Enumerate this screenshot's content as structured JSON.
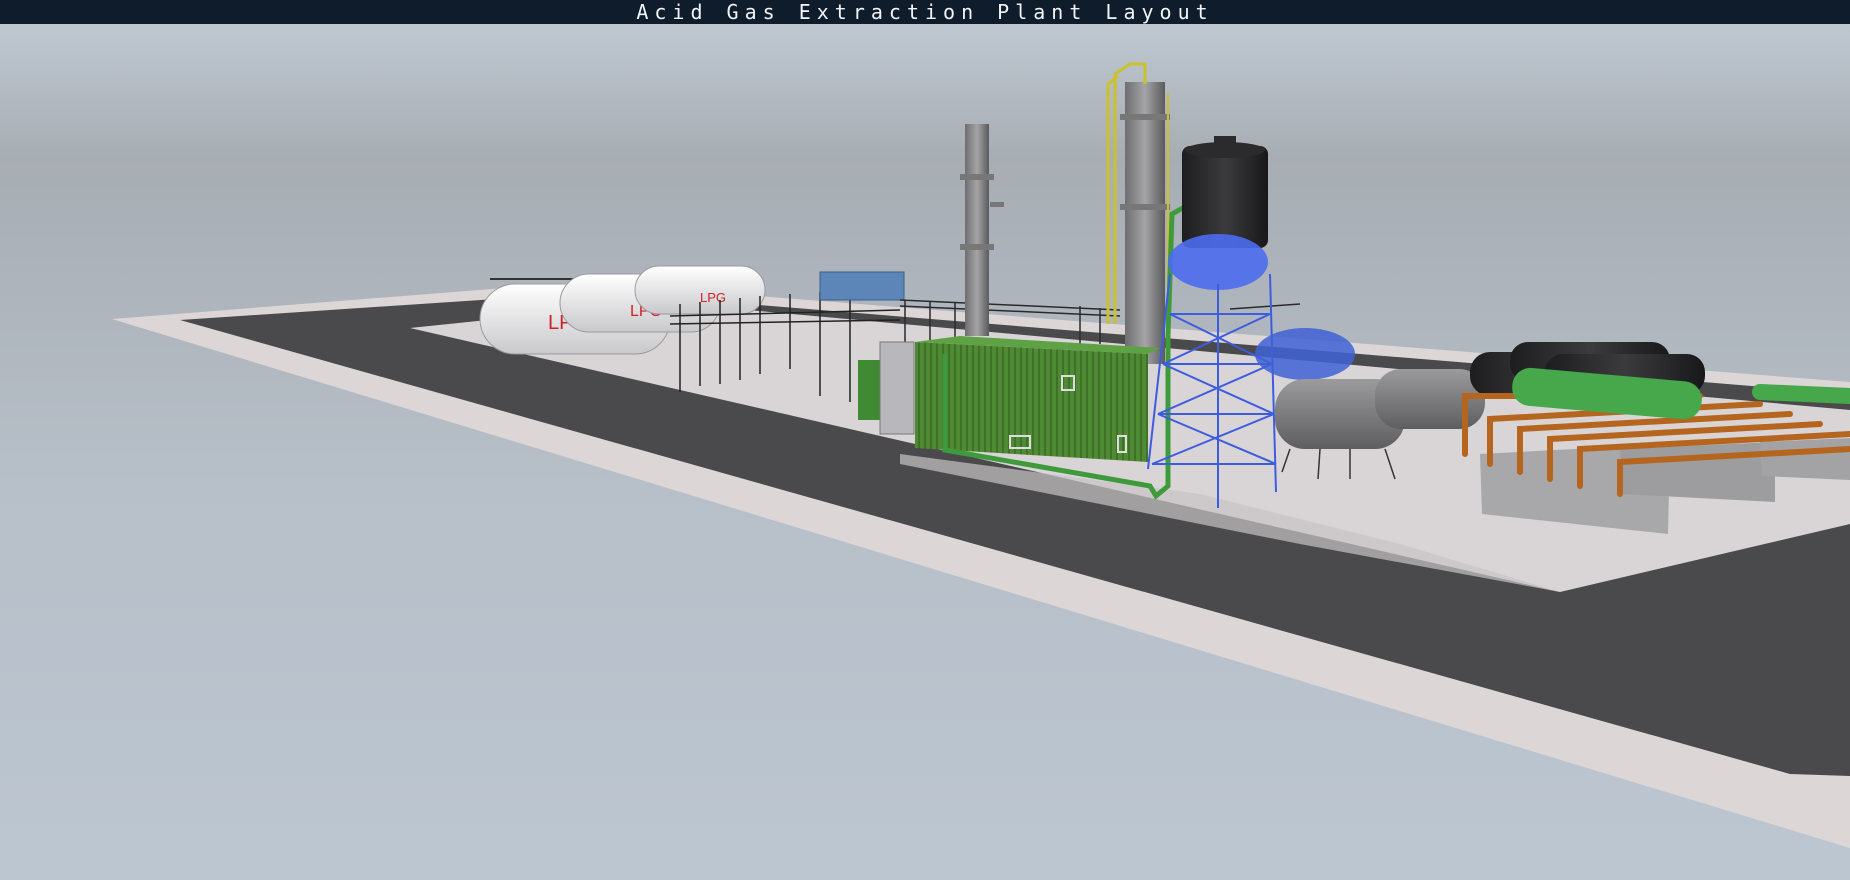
{
  "window": {
    "title": "Acid Gas Extraction Plant Layout"
  },
  "scene": {
    "tank_labels": [
      "LPG",
      "LPG",
      "LPG"
    ],
    "colors": {
      "ground_sand": "#d9d5d6",
      "asphalt": "#4a4a4c",
      "container_green": "#4f8a35",
      "water_tower_blue": "#3d5ce0",
      "black_tank": "#2c2c2e",
      "column_grey": "#8a8a8c",
      "pipe_orange": "#b5651d",
      "pipe_green": "#3f9a3c",
      "pipe_yellow": "#c9c22c",
      "lpg_red": "#d0202a"
    }
  }
}
